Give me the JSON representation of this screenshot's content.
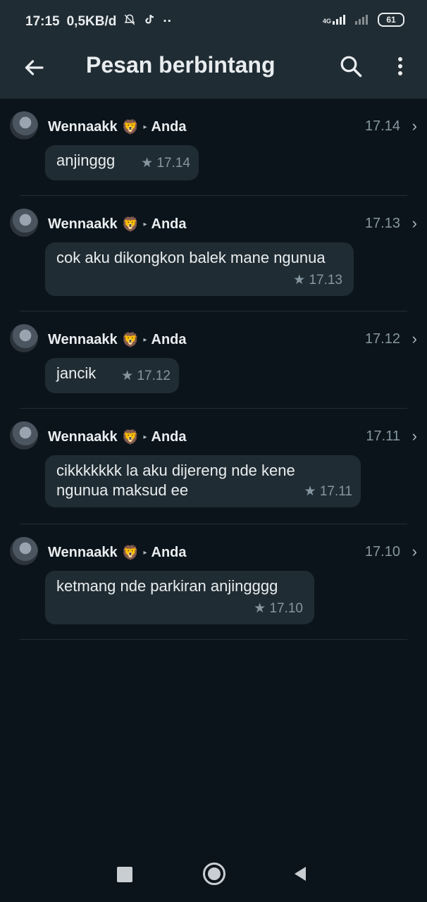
{
  "status": {
    "time": "17:15",
    "rate": "0,5KB/d",
    "network": "4G",
    "battery": "61"
  },
  "appbar": {
    "title": "Pesan berbintang"
  },
  "messages": [
    {
      "from": "Wennaakk",
      "emoji": "🦁",
      "to": "Anda",
      "time": "17.14",
      "text": "anjinggg",
      "star_time": "17.14"
    },
    {
      "from": "Wennaakk",
      "emoji": "🦁",
      "to": "Anda",
      "time": "17.13",
      "text": "cok aku dikongkon balek mane ngunua",
      "star_time": "17.13"
    },
    {
      "from": "Wennaakk",
      "emoji": "🦁",
      "to": "Anda",
      "time": "17.12",
      "text": "jancik",
      "star_time": "17.12"
    },
    {
      "from": "Wennaakk",
      "emoji": "🦁",
      "to": "Anda",
      "time": "17.11",
      "text": "cikkkkkkk la aku dijereng nde kene ngunua maksud ee",
      "star_time": "17.11"
    },
    {
      "from": "Wennaakk",
      "emoji": "🦁",
      "to": "Anda",
      "time": "17.10",
      "text": "ketmang nde parkiran anjingggg",
      "star_time": "17.10"
    }
  ]
}
